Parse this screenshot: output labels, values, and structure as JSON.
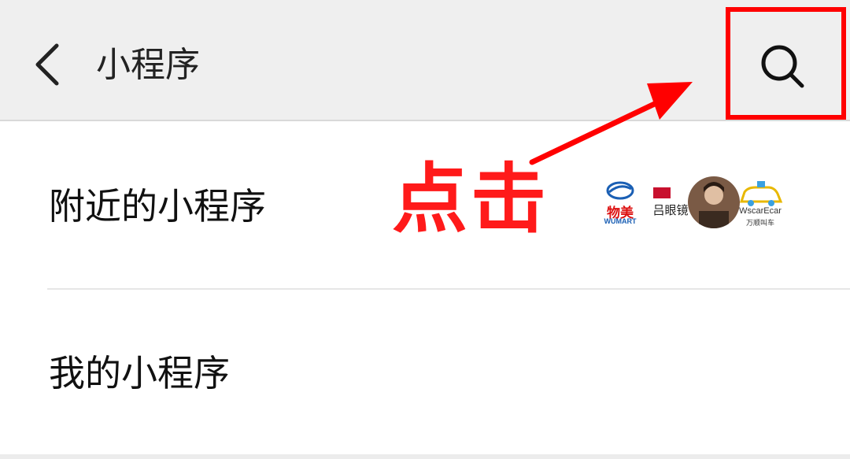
{
  "header": {
    "back_icon": "chevron-left-icon",
    "title": "小程序",
    "search_icon": "search-icon",
    "background": "#efefef"
  },
  "rows": [
    {
      "label": "附近的小程序"
    },
    {
      "label": "我的小程序"
    }
  ],
  "nearby_logos": [
    {
      "text": "物美",
      "subtext": "WUMART"
    },
    {
      "text": "吕眼镜"
    },
    {
      "text": ""
    },
    {
      "text": "WscarEcar",
      "subtext": "万顺叫车"
    }
  ],
  "annotation": {
    "text": "点击",
    "color": "#ff1a1a"
  }
}
